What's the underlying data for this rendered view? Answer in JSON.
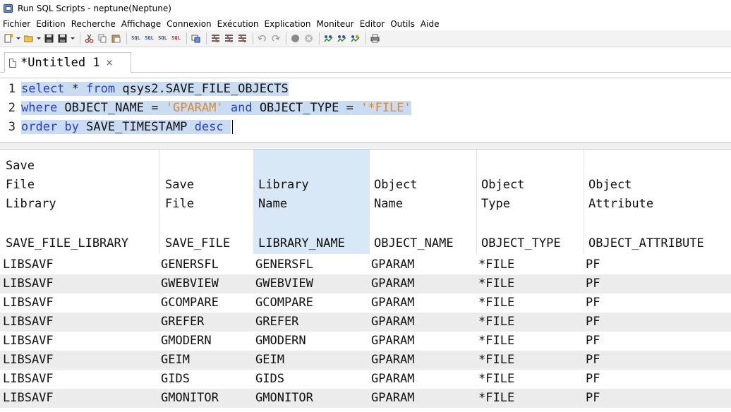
{
  "window": {
    "title": "Run SQL Scripts - neptune(Neptune)"
  },
  "menu": [
    "Fichier",
    "Edition",
    "Recherche",
    "Affichage",
    "Connexion",
    "Exécution",
    "Explication",
    "Moniteur",
    "Editor",
    "Outils",
    "Aide"
  ],
  "toolbar": {
    "sql_label": "SQL"
  },
  "tab": {
    "label": "*Untitled 1",
    "close": "×"
  },
  "editor": {
    "lines": [
      {
        "num": "1",
        "k1": "select",
        "t1": " * ",
        "k2": "from",
        "t2": " qsys2.SAVE_FILE_OBJECTS"
      },
      {
        "num": "2",
        "k1": "where",
        "t1": " OBJECT_NAME = ",
        "s1": "'GPARAM'",
        "t2": " ",
        "k2": "and",
        "t3": " OBJECT_TYPE = ",
        "s2": "'*FILE'"
      },
      {
        "num": "3",
        "k1": "order by",
        "t1": " SAVE_TIMESTAMP ",
        "k2": "desc",
        "t2": " "
      }
    ]
  },
  "grid": {
    "columns": [
      {
        "label": "Save\nFile\nLibrary",
        "name": "SAVE_FILE_LIBRARY"
      },
      {
        "label": "Save\nFile",
        "name": "SAVE_FILE"
      },
      {
        "label": "Library\nName",
        "name": "LIBRARY_NAME"
      },
      {
        "label": "Object\nName",
        "name": "OBJECT_NAME"
      },
      {
        "label": "Object\nType",
        "name": "OBJECT_TYPE"
      },
      {
        "label": "Object\nAttribute",
        "name": "OBJECT_ATTRIBUTE"
      }
    ],
    "rows": [
      [
        "LIBSAVF",
        "GENERSFL",
        "GENERSFL",
        "GPARAM",
        "*FILE",
        "PF"
      ],
      [
        "LIBSAVF",
        "GWEBVIEW",
        "GWEBVIEW",
        "GPARAM",
        "*FILE",
        "PF"
      ],
      [
        "LIBSAVF",
        "GCOMPARE",
        "GCOMPARE",
        "GPARAM",
        "*FILE",
        "PF"
      ],
      [
        "LIBSAVF",
        "GREFER",
        "GREFER",
        "GPARAM",
        "*FILE",
        "PF"
      ],
      [
        "LIBSAVF",
        "GMODERN",
        "GMODERN",
        "GPARAM",
        "*FILE",
        "PF"
      ],
      [
        "LIBSAVF",
        "GEIM",
        "GEIM",
        "GPARAM",
        "*FILE",
        "PF"
      ],
      [
        "LIBSAVF",
        "GIDS",
        "GIDS",
        "GPARAM",
        "*FILE",
        "PF"
      ],
      [
        "LIBSAVF",
        "GMONITOR",
        "GMONITOR",
        "GPARAM",
        "*FILE",
        "PF"
      ]
    ]
  },
  "colors": {
    "keyword": "#2c3fd0",
    "string": "#e0892d",
    "selection": "#c9dcf2",
    "selected_column": "#d8e8f6",
    "alt_row": "#ececec"
  }
}
